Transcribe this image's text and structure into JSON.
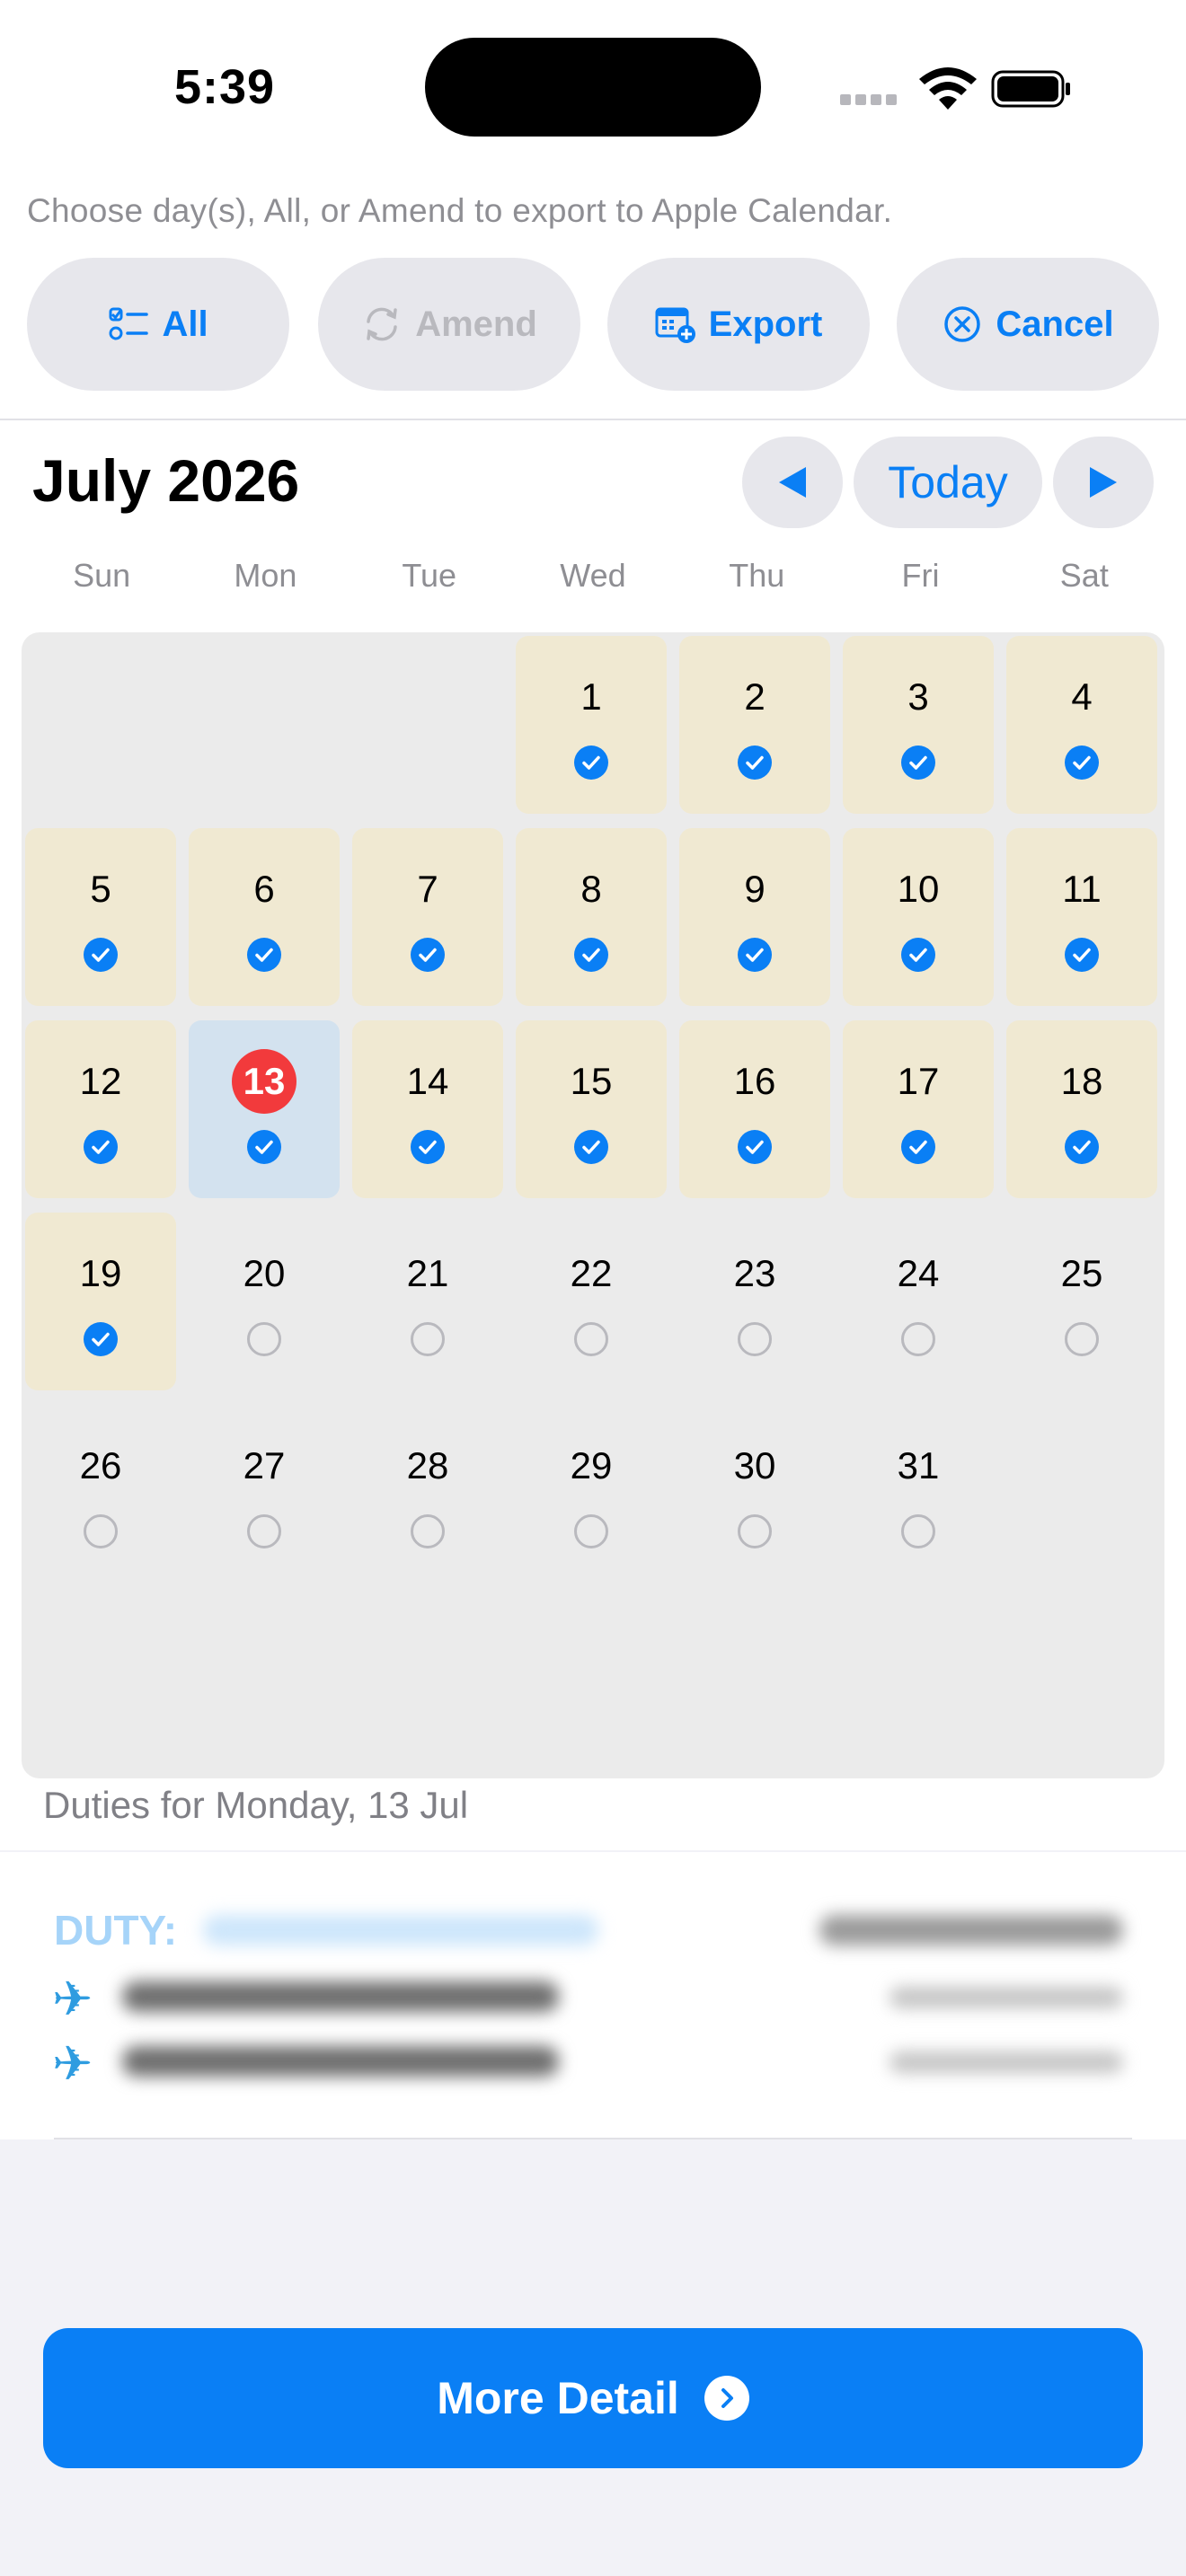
{
  "status_bar": {
    "time": "5:39"
  },
  "instruction": "Choose day(s), All, or Amend to export to Apple Calendar.",
  "toolbar": {
    "all_label": "All",
    "amend_label": "Amend",
    "export_label": "Export",
    "cancel_label": "Cancel"
  },
  "calendar": {
    "month_title": "July 2026",
    "today_label": "Today",
    "weekdays": [
      "Sun",
      "Mon",
      "Tue",
      "Wed",
      "Thu",
      "Fri",
      "Sat"
    ],
    "first_weekday_index": 3,
    "days_in_month": 31,
    "today": 13,
    "selected_days": [
      1,
      2,
      3,
      4,
      5,
      6,
      7,
      8,
      9,
      10,
      11,
      12,
      13,
      14,
      15,
      16,
      17,
      18,
      19
    ]
  },
  "duties": {
    "heading": "Duties for Monday, 13 Jul",
    "duty_label": "DUTY:",
    "flight_icon": "✈"
  },
  "footer": {
    "more_detail_label": "More Detail"
  },
  "colors": {
    "accent": "#0A7FF5",
    "selected_day_bg": "#F0E9D2",
    "today_bg": "#D3E2EF",
    "today_badge": "#F23A3C"
  }
}
